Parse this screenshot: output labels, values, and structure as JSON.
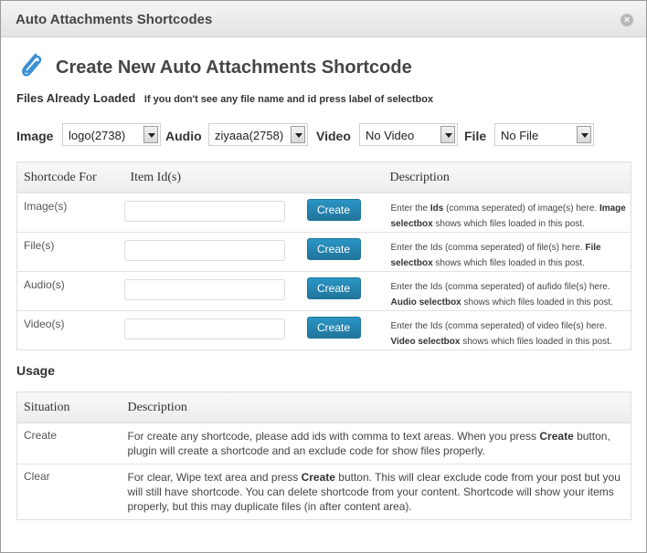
{
  "window": {
    "title": "Auto Attachments Shortcodes",
    "close_icon": "close-icon"
  },
  "heading": {
    "title": "Create New Auto Attachments Shortcode",
    "icon": "paperclip-icon"
  },
  "loaded": {
    "label": "Files Already Loaded",
    "hint": "If you don't see any file name and id press label of selectbox"
  },
  "selects": [
    {
      "label": "Image",
      "value": "logo(2738)"
    },
    {
      "label": "Audio",
      "value": "ziyaaa(2758)"
    },
    {
      "label": "Video",
      "value": "No Video"
    },
    {
      "label": "File",
      "value": "No File"
    }
  ],
  "shortcode_table": {
    "headers": [
      "Shortcode For",
      "Item Id(s)",
      "Description"
    ],
    "rows": [
      {
        "name": "Image(s)",
        "button": "Create",
        "desc_pre": "Enter the ",
        "desc_b1": "Ids",
        "desc_mid": " (comma seperated) of image(s) here. ",
        "desc_b2": "Image selectbox",
        "desc_post": " shows which files loaded in this post."
      },
      {
        "name": "File(s)",
        "button": "Create",
        "desc_pre": "Enter the Ids (comma seperated) of file(s) here. ",
        "desc_b1": "",
        "desc_mid": "",
        "desc_b2": "File selectbox",
        "desc_post": " shows which files loaded in this post."
      },
      {
        "name": "Audio(s)",
        "button": "Create",
        "desc_pre": "Enter the Ids (comma seperated) of aufido file(s) here. ",
        "desc_b1": "",
        "desc_mid": "",
        "desc_b2": "Audio selectbox",
        "desc_post": " shows which files loaded in this post."
      },
      {
        "name": "Video(s)",
        "button": "Create",
        "desc_pre": "Enter the Ids (comma seperated) of video file(s) here. ",
        "desc_b1": "",
        "desc_mid": "",
        "desc_b2": "Video selectbox",
        "desc_post": " shows which files loaded in this post."
      }
    ]
  },
  "usage": {
    "title": "Usage",
    "headers": [
      "Situation",
      "Description"
    ],
    "rows": [
      {
        "situation": "Create",
        "desc_pre": "For create any shortcode, please add ids with comma to text areas. When you press ",
        "desc_b": "Create",
        "desc_post": " button, plugin will create a shortcode and an exclude code for show files properly."
      },
      {
        "situation": "Clear",
        "desc_pre": "For clear, Wipe text area and press ",
        "desc_b": "Create",
        "desc_post": " button. This will clear exclude code from your post but you will still have shortcode. You can delete shortcode from your content. Shortcode will show your items properly, but this may duplicate files (in after content area)."
      }
    ]
  },
  "colors": {
    "button": "#21759b",
    "title_text": "#464646"
  }
}
